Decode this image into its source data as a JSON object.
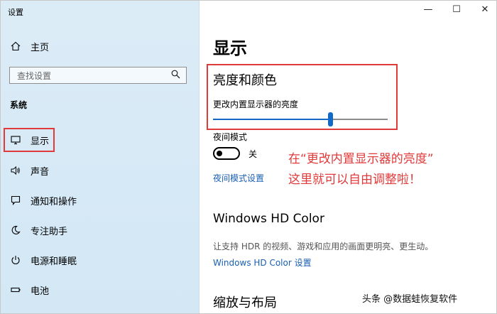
{
  "app": {
    "title": "设置"
  },
  "window_controls": {
    "minimize": "—",
    "maximize": "☐",
    "close": "✕"
  },
  "sidebar": {
    "home": "主页",
    "search_placeholder": "查找设置",
    "section": "系统",
    "items": [
      {
        "label": "显示",
        "icon": "monitor-icon"
      },
      {
        "label": "声音",
        "icon": "speaker-icon"
      },
      {
        "label": "通知和操作",
        "icon": "notification-icon"
      },
      {
        "label": "专注助手",
        "icon": "moon-icon"
      },
      {
        "label": "电源和睡眠",
        "icon": "power-icon"
      },
      {
        "label": "电池",
        "icon": "battery-icon"
      }
    ]
  },
  "main": {
    "title": "显示",
    "brightness_section": "亮度和颜色",
    "brightness_label": "更改内置显示器的亮度",
    "brightness_value": 0.67,
    "night_mode_label": "夜间模式",
    "night_mode_state": "关",
    "night_mode_settings_link": "夜间模式设置",
    "hdr_title": "Windows HD Color",
    "hdr_desc": "让支持 HDR 的视频、游戏和应用的画面更明亮、更生动。",
    "hdr_link": "Windows HD Color 设置",
    "layout_title": "缩放与布局"
  },
  "annotation": {
    "line1": "在“更改内置显示器的亮度”",
    "line2": "这里就可以自由调整啦！"
  },
  "watermark": "头条 @数据蛙恢复软件",
  "colors": {
    "accent": "#1269c6",
    "annotation": "#e03a3a",
    "sidebar_bg": "#d6e9f6"
  }
}
